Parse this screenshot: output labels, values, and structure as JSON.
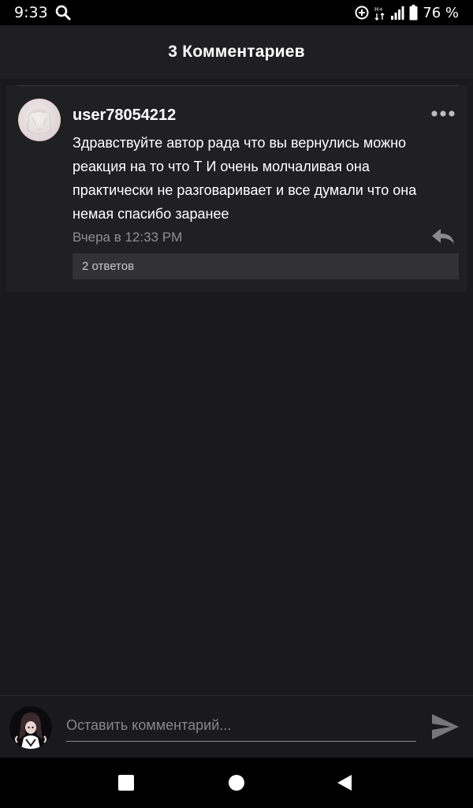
{
  "status_bar": {
    "time": "9:33",
    "battery": "76 %"
  },
  "header": {
    "title": "3 Комментариев"
  },
  "comment": {
    "username": "user78054212",
    "text": "Здравствуйте автор рада что вы вернулись можно реакция на то что Т И очень молчаливая она практически не разговаривает и все думали что она немая спасибо заранее",
    "time": "Вчера в 12:33 PM",
    "replies_label": "2 ответов"
  },
  "input_bar": {
    "placeholder": "Оставить комментарий..."
  },
  "colors": {
    "background": "#1a191b",
    "card": "#201f22",
    "muted_text": "#8f8e92",
    "replies_bg": "#323134"
  },
  "icons": {
    "status_search": "search-icon",
    "more": "more-dots-icon",
    "reply": "reply-arrow-icon",
    "send": "send-icon",
    "nav_recents": "square-recents-icon",
    "nav_home": "circle-home-icon",
    "nav_back": "triangle-back-icon"
  }
}
